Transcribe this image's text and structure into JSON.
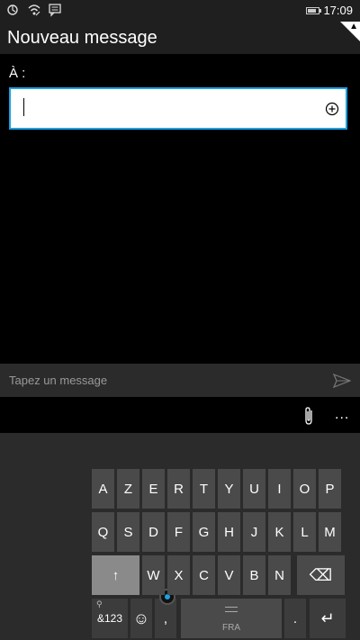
{
  "status_bar": {
    "time": "17:09",
    "battery_level": 0.85,
    "icons": [
      "sync-icon",
      "wifi-icon",
      "notification-icon",
      "battery-icon"
    ]
  },
  "header": {
    "title": "Nouveau message",
    "badge_glyph": "▲"
  },
  "recipient": {
    "label": "À :",
    "value": "",
    "add_icon": "add-contact-icon"
  },
  "compose": {
    "placeholder": "Tapez un message",
    "send_icon": "send-icon"
  },
  "toolbar": {
    "attach_icon": "paperclip-icon",
    "more_label": "..."
  },
  "keyboard": {
    "row1": [
      "A",
      "Z",
      "E",
      "R",
      "T",
      "Y",
      "U",
      "I",
      "O",
      "P"
    ],
    "row2": [
      "Q",
      "S",
      "D",
      "F",
      "G",
      "H",
      "J",
      "K",
      "L",
      "M"
    ],
    "row3": [
      "W",
      "X",
      "C",
      "V",
      "B",
      "N"
    ],
    "shift_label": "↑",
    "backspace_label": "⌫",
    "symbols_label": "&123",
    "symbols_sub": "⚲",
    "emoji_label": "☺",
    "comma_label": ",",
    "period_label": ".",
    "space_lang": "FRA",
    "enter_label": "↵"
  },
  "colors": {
    "accent": "#1ba1e2",
    "background": "#000000",
    "panel": "#2b2b2b",
    "key": "#4a4a4a"
  }
}
